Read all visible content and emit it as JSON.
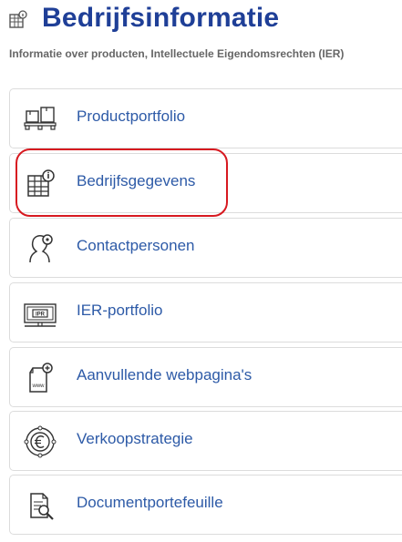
{
  "header": {
    "title": "Bedrijfsinformatie",
    "subtitle": "Informatie over producten, Intellectuele Eigendomsrechten (IER)",
    "icon": "building-info-icon"
  },
  "menu": {
    "items": [
      {
        "label": "Productportfolio",
        "icon": "product-boxes-icon"
      },
      {
        "label": "Bedrijfsgegevens",
        "icon": "building-info-icon",
        "highlighted": true
      },
      {
        "label": "Contactpersonen",
        "icon": "contact-person-icon"
      },
      {
        "label": "IER-portfolio",
        "icon": "ipr-portfolio-icon",
        "icon_text": "IPR"
      },
      {
        "label": "Aanvullende webpagina's",
        "icon": "add-webpage-icon",
        "icon_text": "www"
      },
      {
        "label": "Verkoopstrategie",
        "icon": "euro-strategy-icon"
      },
      {
        "label": "Documentportefeuille",
        "icon": "document-search-icon"
      }
    ]
  },
  "colors": {
    "title": "#1f3f97",
    "link": "#2d5aa7",
    "subtitle": "#666666",
    "highlight": "#d71920",
    "border": "#dcdcdc"
  }
}
